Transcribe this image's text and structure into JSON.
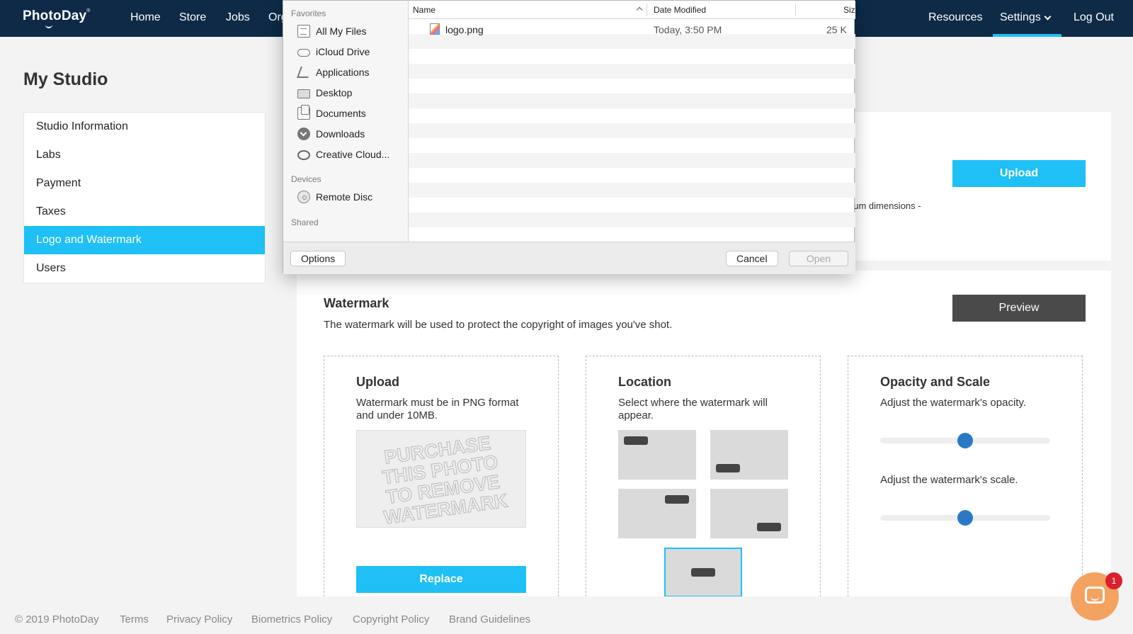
{
  "nav": {
    "logo": "PhotoDay",
    "logo_mark": "®",
    "links": [
      "Home",
      "Store",
      "Jobs",
      "Org"
    ],
    "resources": "Resources",
    "settings": "Settings",
    "logout": "Log Out"
  },
  "page": {
    "title": "My Studio"
  },
  "sidebar": {
    "items": [
      {
        "label": "Studio Information"
      },
      {
        "label": "Labs"
      },
      {
        "label": "Payment"
      },
      {
        "label": "Taxes"
      },
      {
        "label": "Logo and Watermark",
        "active": true
      },
      {
        "label": "Users"
      }
    ]
  },
  "logo_panel": {
    "upload_label": "Upload",
    "dimensions_fragment": "num dimensions -"
  },
  "watermark": {
    "title": "Watermark",
    "description": "The watermark will be used to protect the copyright of images you've shot.",
    "preview_label": "Preview",
    "upload_card": {
      "title": "Upload",
      "description": "Watermark must be in PNG format and under 10MB.",
      "image_text": [
        "PURCHASE",
        "THIS PHOTO",
        "TO REMOVE",
        "WATERMARK"
      ],
      "replace_label": "Replace"
    },
    "location_card": {
      "title": "Location",
      "description": "Select where the watermark will appear.",
      "selected": "center"
    },
    "opacity_card": {
      "title": "Opacity and Scale",
      "opacity_label": "Adjust the watermark's opacity.",
      "opacity_value": 0.5,
      "scale_label": "Adjust the watermark's scale.",
      "scale_value": 0.5
    }
  },
  "footer": {
    "copyright": "© 2019 PhotoDay",
    "links": [
      "Terms",
      "Privacy Policy",
      "Biometrics Policy",
      "Copyright Policy",
      "Brand Guidelines"
    ]
  },
  "chat": {
    "badge": "1"
  },
  "dialog": {
    "favorites_label": "Favorites",
    "favorites": [
      {
        "label": "All My Files",
        "icon": "all-files-icon"
      },
      {
        "label": "iCloud Drive",
        "icon": "icloud-icon"
      },
      {
        "label": "Applications",
        "icon": "applications-icon"
      },
      {
        "label": "Desktop",
        "icon": "desktop-icon"
      },
      {
        "label": "Documents",
        "icon": "documents-icon"
      },
      {
        "label": "Downloads",
        "icon": "downloads-icon"
      },
      {
        "label": "Creative Cloud...",
        "icon": "creative-cloud-icon"
      }
    ],
    "devices_label": "Devices",
    "devices": [
      {
        "label": "Remote Disc",
        "icon": "remote-disc-icon"
      }
    ],
    "shared_label": "Shared",
    "columns": {
      "name": "Name",
      "date": "Date Modified",
      "size": "Siz"
    },
    "file": {
      "name": "logo.png",
      "date": "Today, 3:50 PM",
      "size": "25 K"
    },
    "options_label": "Options",
    "cancel_label": "Cancel",
    "open_label": "Open"
  },
  "colors": {
    "nav_bg": "#0e2a47",
    "accent": "#1ec0f5",
    "preview_bg": "#4a4a4a",
    "knob": "#2979c7",
    "chat": "#f4a260",
    "badge": "#d9202c"
  }
}
